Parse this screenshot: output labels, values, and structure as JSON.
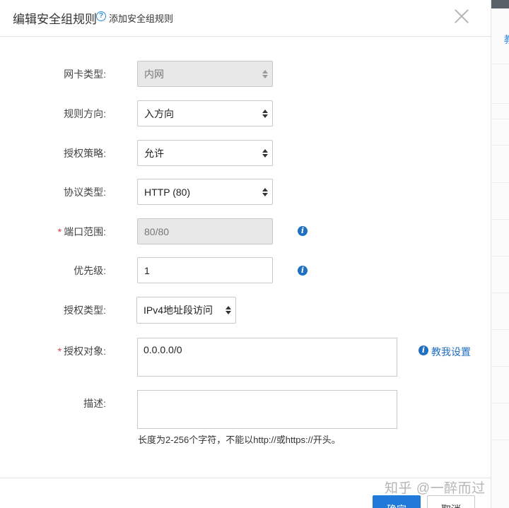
{
  "modal": {
    "title": "编辑安全组规则",
    "help_icon_glyph": "?",
    "help_link": "添加安全组规则"
  },
  "form": {
    "nic_type": {
      "label": "网卡类型:",
      "value": "内网",
      "disabled": true
    },
    "direction": {
      "label": "规则方向:",
      "value": "入方向"
    },
    "policy": {
      "label": "授权策略:",
      "value": "允许"
    },
    "protocol": {
      "label": "协议类型:",
      "value": "HTTP (80)"
    },
    "port_range": {
      "required_mark": "*",
      "label": "端口范围:",
      "value": "80/80",
      "disabled": true
    },
    "priority": {
      "label": "优先级:",
      "value": "1"
    },
    "auth_type": {
      "label": "授权类型:",
      "value": "IPv4地址段访问"
    },
    "auth_object": {
      "required_mark": "*",
      "label": "授权对象:",
      "value": "0.0.0.0/0"
    },
    "description": {
      "label": "描述:",
      "value": "",
      "hint": "长度为2-256个字符，不能以http://或https://开头。"
    }
  },
  "info_icon_glyph": "i",
  "tutorial_link": "教我设置",
  "footer": {
    "confirm_label": "确定",
    "cancel_label": "取消"
  },
  "background": {
    "edge_text": "教"
  },
  "watermark": "知乎 @一醉而过",
  "colors": {
    "primary": "#1f7ad9",
    "link": "#1f6fc2",
    "required": "#e4393c",
    "disabled_bg": "#e8e8e8"
  }
}
